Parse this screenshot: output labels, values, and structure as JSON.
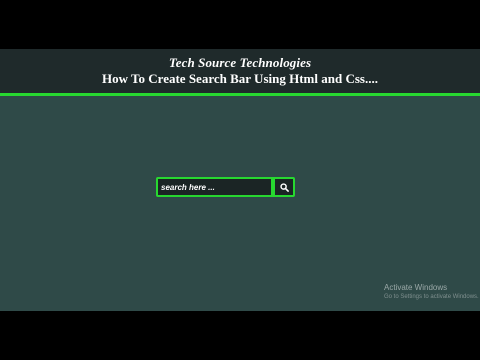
{
  "header": {
    "title": "Tech Source Technologies",
    "subtitle": "How To Create Search Bar Using Html and Css...."
  },
  "search": {
    "placeholder": "search here ...",
    "value": "",
    "button_icon": "search-icon"
  },
  "watermark": {
    "title": "Activate Windows",
    "subtitle": "Go to Settings to activate Windows."
  },
  "colors": {
    "accent": "#27d830",
    "header_bg": "#1f2a2b",
    "page_bg": "#2f4a48",
    "input_bg": "#1b2525",
    "text": "#ffffff"
  }
}
